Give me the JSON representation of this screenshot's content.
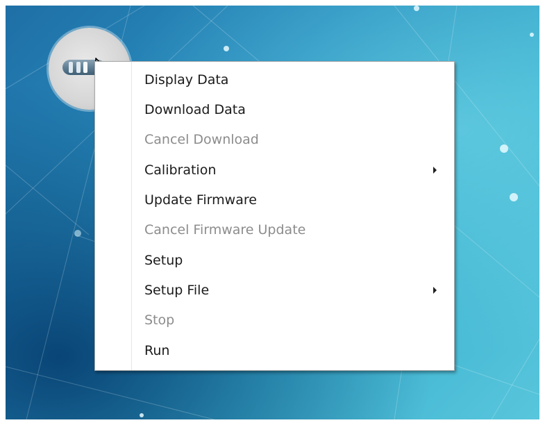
{
  "menu": {
    "items": [
      {
        "label": "Display Data",
        "enabled": true,
        "submenu": false
      },
      {
        "label": "Download Data",
        "enabled": true,
        "submenu": false
      },
      {
        "label": "Cancel Download",
        "enabled": false,
        "submenu": false
      },
      {
        "label": "Calibration",
        "enabled": true,
        "submenu": true
      },
      {
        "label": "Update Firmware",
        "enabled": true,
        "submenu": false
      },
      {
        "label": "Cancel Firmware Update",
        "enabled": false,
        "submenu": false
      },
      {
        "label": "Setup",
        "enabled": true,
        "submenu": false
      },
      {
        "label": "Setup File",
        "enabled": true,
        "submenu": true
      },
      {
        "label": "Stop",
        "enabled": false,
        "submenu": false
      },
      {
        "label": "Run",
        "enabled": true,
        "submenu": false
      }
    ]
  },
  "icons": {
    "device": "data-logger-icon",
    "cursor": "mouse-pointer-icon",
    "submenu_arrow": "chevron-right-icon"
  },
  "colors": {
    "menu_background": "#ffffff",
    "enabled_text": "#1a1a1a",
    "disabled_text": "#8c8c8c",
    "desktop_accent": "#2a8fbf"
  }
}
